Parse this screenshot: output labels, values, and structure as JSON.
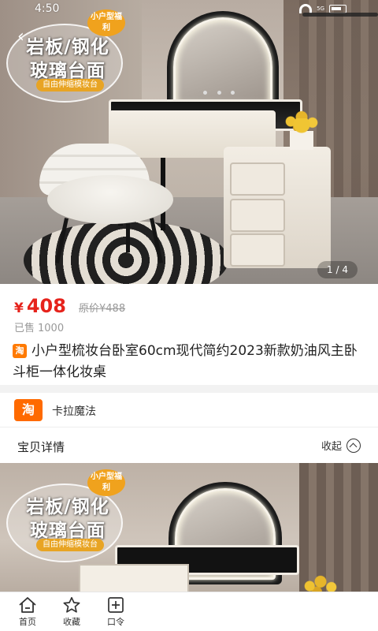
{
  "status_bar": {
    "time": "4:50",
    "network_badge": "5G",
    "battery_label": "43"
  },
  "hero": {
    "promo_tag": "小户型福利",
    "promo_line1": "岩板/钢化",
    "promo_line2": "玻璃台面",
    "promo_sub": "自由伸缩模妆台",
    "page_indicator": "1 / 4"
  },
  "product": {
    "currency": "¥",
    "price": "408",
    "original_price": "原价¥488",
    "sold_label": "已售",
    "sold_count": "1000",
    "platform_badge": "淘",
    "title": "小户型梳妆台卧室60cm现代简约2023新款奶油风主卧斗柜一体化妆桌"
  },
  "shop": {
    "logo_text": "淘",
    "name": "卡拉魔法"
  },
  "details": {
    "title": "宝贝详情",
    "collapse_label": "收起"
  },
  "detail_image": {
    "promo_tag": "小户型福利",
    "promo_line1": "岩板/钢化",
    "promo_line2": "玻璃台面",
    "promo_sub": "自由伸缩模妆台"
  },
  "bottom_nav": {
    "items": [
      {
        "label": "首页",
        "icon": "home-icon"
      },
      {
        "label": "收藏",
        "icon": "star-icon"
      },
      {
        "label": "口令",
        "icon": "command-icon"
      }
    ]
  },
  "colors": {
    "price_red": "#e6231c",
    "taobao_orange": "#ff6a00",
    "promo_orange": "#f0a21d"
  }
}
